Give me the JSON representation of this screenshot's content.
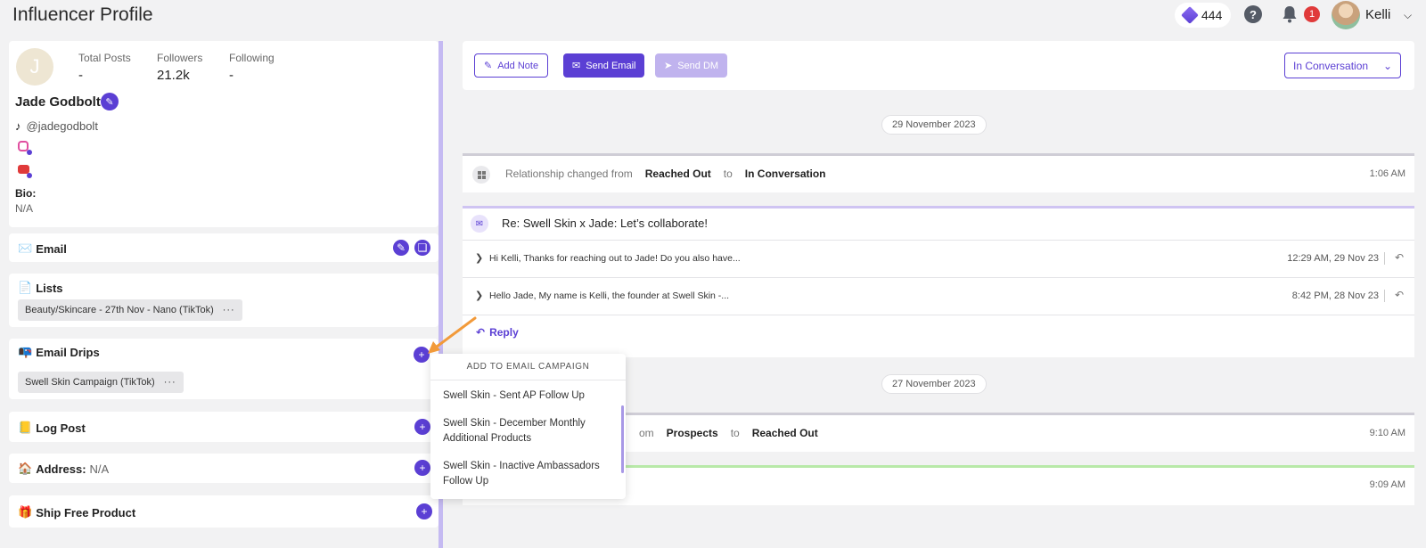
{
  "header": {
    "title": "Influencer Profile",
    "credits": "444",
    "help_glyph": "?",
    "notifications": "1",
    "user_name": "Kelli"
  },
  "profile": {
    "avatar_initial": "J",
    "stats": [
      {
        "label": "Total Posts",
        "value": "-"
      },
      {
        "label": "Followers",
        "value": "21.2k"
      },
      {
        "label": "Following",
        "value": "-"
      }
    ],
    "name": "Jade Godbolt",
    "handle": "@jadegodbolt",
    "bio_label": "Bio:",
    "bio_value": "N/A"
  },
  "sections": {
    "email": {
      "emoji": "✉️",
      "label": "Email"
    },
    "lists": {
      "emoji": "📄",
      "label": "Lists",
      "chip": "Beauty/Skincare - 27th Nov - Nano (TikTok)"
    },
    "drips": {
      "emoji": "📭",
      "label": "Email Drips",
      "chip": "Swell Skin Campaign (TikTok)"
    },
    "log_post": {
      "emoji": "📒",
      "label": "Log Post"
    },
    "address": {
      "emoji": "🏠",
      "label": "Address:",
      "value": "N/A"
    },
    "ship": {
      "emoji": "🎁",
      "label": "Ship Free Product"
    }
  },
  "toolbar": {
    "add_note": "Add Note",
    "send_email": "Send Email",
    "send_dm": "Send DM",
    "status": "In Conversation"
  },
  "timeline": {
    "date1": "29 November 2023",
    "event1": {
      "prefix": "Relationship changed from",
      "from": "Reached Out",
      "to_word": "to",
      "to": "In Conversation",
      "time": "1:06 AM"
    },
    "thread": {
      "subject": "Re: Swell Skin x Jade: Let’s collaborate!",
      "messages": [
        {
          "preview": "Hi Kelli, Thanks for reaching out to Jade! Do you also have...",
          "time": "12:29 AM, 29 Nov 23"
        },
        {
          "preview": "Hello Jade, My name is Kelli, the founder at Swell Skin -...",
          "time": "8:42 PM, 28 Nov 23"
        }
      ],
      "reply": "Reply"
    },
    "date2": "27 November 2023",
    "event2": {
      "prefix": "om",
      "from": "Prospects",
      "to_word": "to",
      "to": "Reached Out",
      "time": "9:10 AM"
    },
    "event3_time": "9:09 AM"
  },
  "dropdown": {
    "title": "ADD TO EMAIL CAMPAIGN",
    "items": [
      "Swell Skin - Sent AP Follow Up",
      "Swell Skin - December Monthly Additional Products",
      "Swell Skin - Inactive Ambassadors Follow Up"
    ]
  },
  "colors": {
    "accent": "#5b3fd4",
    "annotation_arrow": "#f29a3a"
  }
}
